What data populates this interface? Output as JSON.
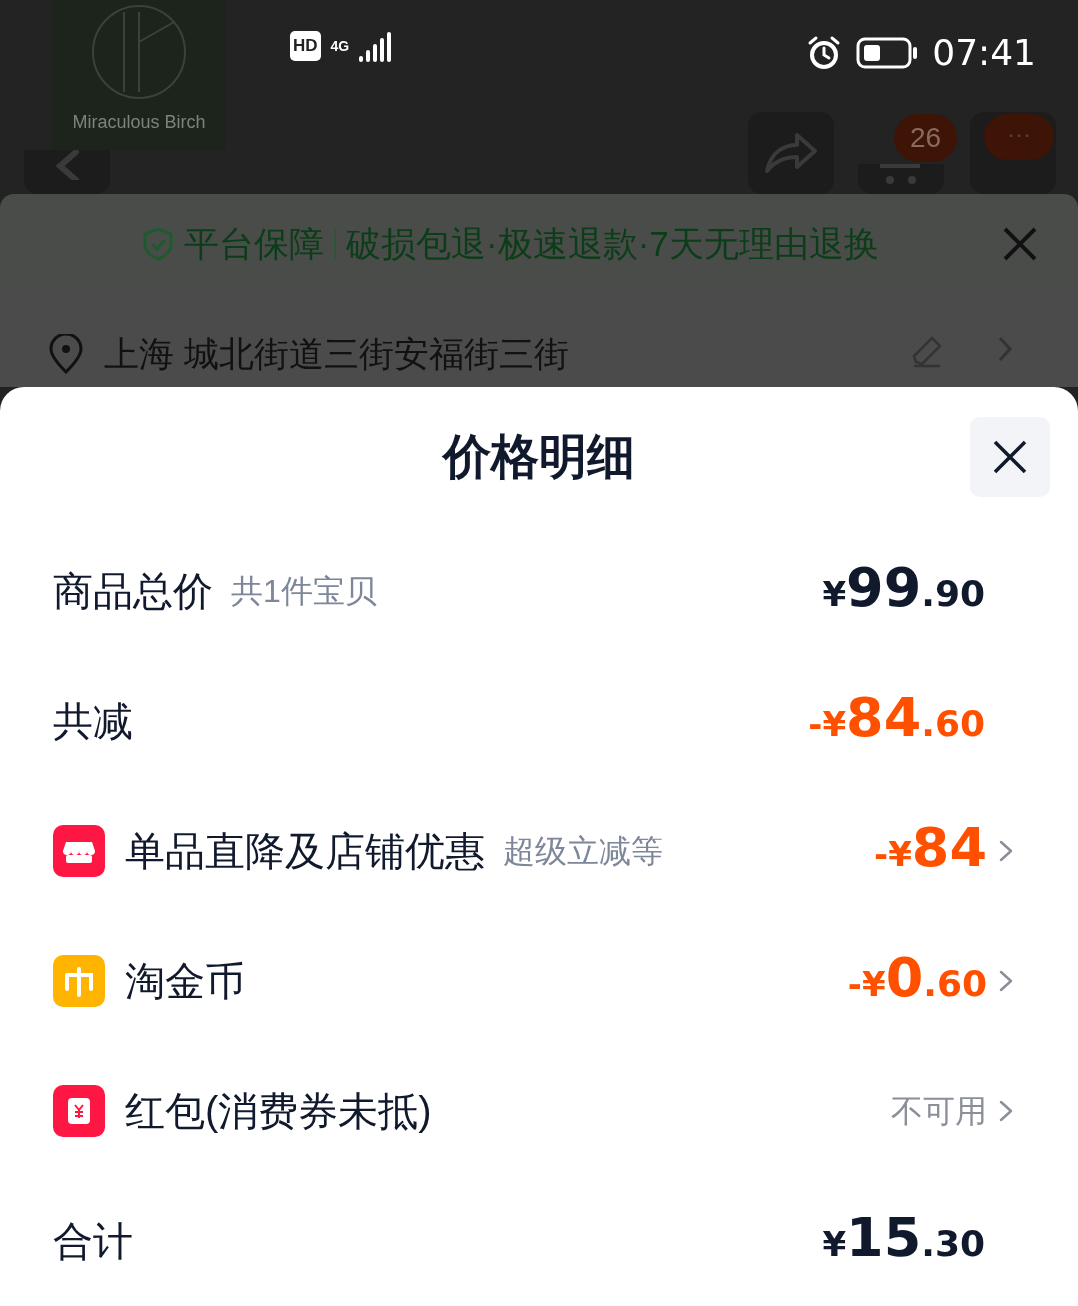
{
  "status_bar": {
    "hd": "HD",
    "network": "4G",
    "time": "07:41"
  },
  "header": {
    "logo_text": "Miraculous Birch",
    "cart_badge": "26",
    "more_badge": "···"
  },
  "guarantee": {
    "title": "平台保障",
    "text": "破损包退·极速退款·7天无理由退换"
  },
  "address": {
    "text": "上海 城北街道三街安福街三街"
  },
  "sheet": {
    "title": "价格明细",
    "summary": [
      {
        "kind": "normal",
        "label": "商品总价",
        "note": "共1件宝贝",
        "price": {
          "currency": "¥",
          "integer": "99",
          "decimal": ".90"
        }
      },
      {
        "kind": "discount",
        "label": "共减",
        "price": {
          "sign": "-",
          "currency": "¥",
          "integer": "84",
          "decimal": ".60"
        }
      }
    ],
    "items": [
      {
        "kind": "store",
        "label": "单品直降及店铺优惠",
        "note": "超级立减等",
        "price": {
          "sign": "-",
          "currency": "¥",
          "integer": "84"
        }
      },
      {
        "kind": "coin",
        "label": "淘金币",
        "price": {
          "sign": "-",
          "currency": "¥",
          "integer": "0",
          "decimal": ".60"
        }
      },
      {
        "kind": "envelope",
        "label": "红包(消费券未抵)",
        "status": "不可用"
      }
    ],
    "total": {
      "label": "合计",
      "price": {
        "currency": "¥",
        "integer": "15",
        "decimal": ".30"
      }
    }
  }
}
